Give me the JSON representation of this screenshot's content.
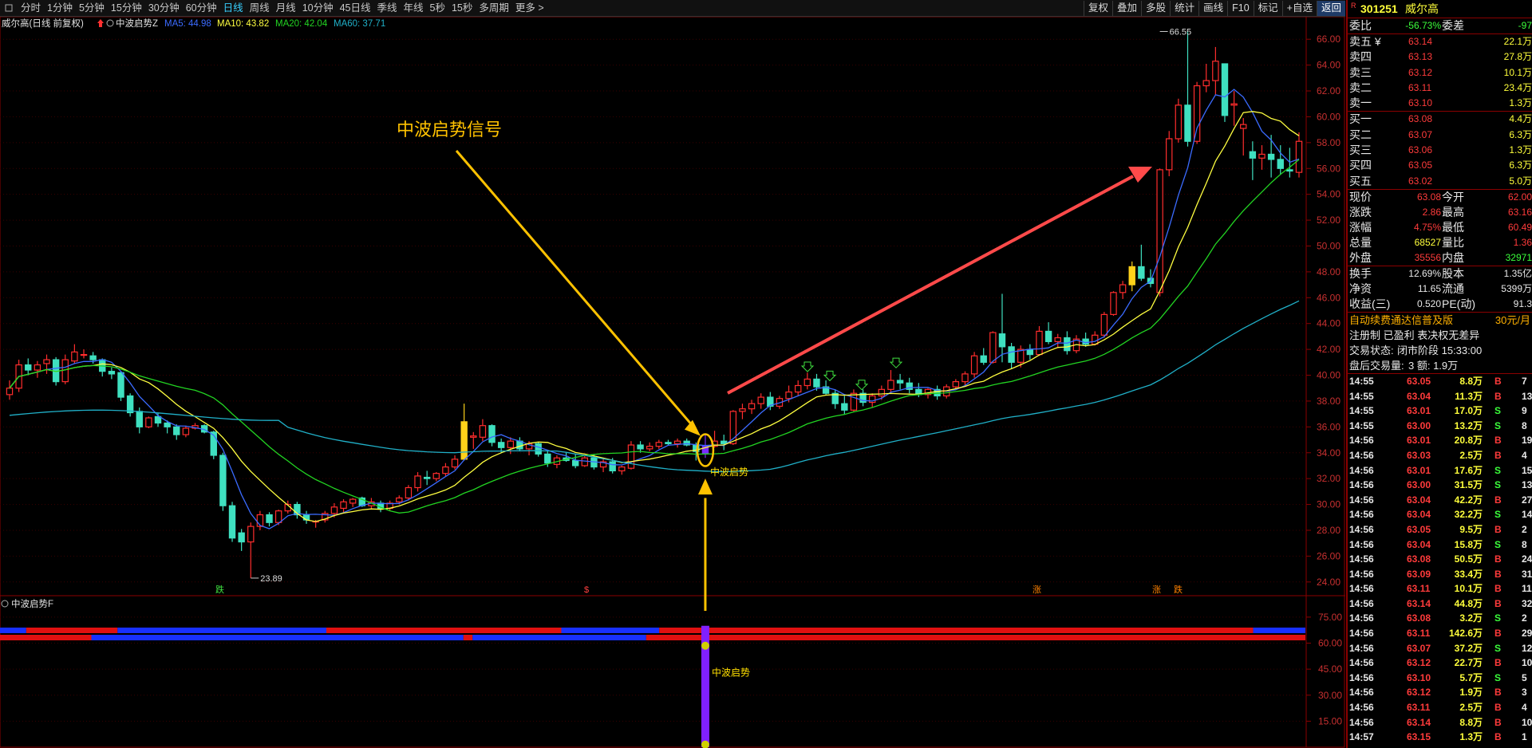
{
  "toolbar": {
    "periods": [
      "分时",
      "1分钟",
      "5分钟",
      "15分钟",
      "30分钟",
      "60分钟",
      "日线",
      "周线",
      "月线",
      "10分钟",
      "45日线",
      "季线",
      "年线",
      "5秒",
      "15秒",
      "多周期",
      "更多 >"
    ],
    "active_period": "日线",
    "right_buttons": [
      "复权",
      "叠加",
      "多股",
      "统计",
      "画线",
      "F10",
      "标记",
      "+自选",
      "返回"
    ]
  },
  "main_info": {
    "title": "威尔高(日线 前复权)",
    "indicator": "中波启势Z",
    "ma5": "MA5: 44.98",
    "ma10": "MA10: 43.82",
    "ma20": "MA20: 42.04",
    "ma60": "MA60: 37.71"
  },
  "annotation": {
    "text": "中波启势信号",
    "signal_label": "中波启势",
    "high_label": "66.55",
    "low_label": "23.89"
  },
  "markers": [
    "跌",
    "$",
    "涨",
    "涨",
    "跌"
  ],
  "sub_panel": {
    "title": "中波启势F",
    "signal_label": "中波启势",
    "yticks": [
      "75.00",
      "60.00",
      "45.00",
      "30.00",
      "15.00"
    ]
  },
  "price_axis": [
    "66.00",
    "64.00",
    "62.00",
    "60.00",
    "58.00",
    "56.00",
    "54.00",
    "52.00",
    "50.00",
    "48.00",
    "46.00",
    "44.00",
    "42.00",
    "40.00",
    "38.00",
    "36.00",
    "34.00",
    "32.00",
    "30.00",
    "28.00",
    "26.00",
    "24.00"
  ],
  "quote": {
    "badge": "R",
    "code": "301251",
    "name": "威尔高",
    "weibi_label": "委比",
    "weibi": "-56.73%",
    "weicha_label": "委差",
    "weicha": "-97",
    "asks": [
      {
        "label": "卖五 ¥",
        "price": "63.14",
        "vol": "22.1万"
      },
      {
        "label": "卖四",
        "price": "63.13",
        "vol": "27.8万"
      },
      {
        "label": "卖三",
        "price": "63.12",
        "vol": "10.1万"
      },
      {
        "label": "卖二",
        "price": "63.11",
        "vol": "23.4万"
      },
      {
        "label": "卖一",
        "price": "63.10",
        "vol": "1.3万"
      }
    ],
    "bids": [
      {
        "label": "买一",
        "price": "63.08",
        "vol": "4.4万"
      },
      {
        "label": "买二",
        "price": "63.07",
        "vol": "6.3万"
      },
      {
        "label": "买三",
        "price": "63.06",
        "vol": "1.3万"
      },
      {
        "label": "买四",
        "price": "63.05",
        "vol": "6.3万"
      },
      {
        "label": "买五",
        "price": "63.02",
        "vol": "5.0万"
      }
    ],
    "stats": [
      {
        "l1": "现价",
        "v1": "63.08",
        "c1": "red",
        "l2": "今开",
        "v2": "62.00",
        "c2": "red"
      },
      {
        "l1": "涨跌",
        "v1": "2.86",
        "c1": "red",
        "l2": "最高",
        "v2": "63.16",
        "c2": "red"
      },
      {
        "l1": "涨幅",
        "v1": "4.75%",
        "c1": "red",
        "l2": "最低",
        "v2": "60.49",
        "c2": "red"
      },
      {
        "l1": "总量",
        "v1": "68527",
        "c1": "yel",
        "l2": "量比",
        "v2": "1.36",
        "c2": "red"
      },
      {
        "l1": "外盘",
        "v1": "35556",
        "c1": "red",
        "l2": "内盘",
        "v2": "32971",
        "c2": "green"
      }
    ],
    "stats2": [
      {
        "l1": "换手",
        "v1": "12.69%",
        "l2": "股本",
        "v2": "1.35亿"
      },
      {
        "l1": "净资",
        "v1": "11.65",
        "l2": "流通",
        "v2": "5399万"
      },
      {
        "l1": "收益(三)",
        "v1": "0.520",
        "l2": "PE(动)",
        "v2": "91.3"
      }
    ],
    "ad_text": "自动续费通达信普及版",
    "ad_price": "30元/月",
    "reg_text": "注册制 已盈利 表决权无差异",
    "status_label": "交易状态:",
    "status_value": "闭市阶段 15:33:00",
    "after_label": "盘后交易量:",
    "after_value": "3 额: 1.9万"
  },
  "ticks": [
    {
      "t": "14:55",
      "p": "63.05",
      "v": "8.8万",
      "s": "B",
      "n": "7"
    },
    {
      "t": "14:55",
      "p": "63.04",
      "v": "11.3万",
      "s": "B",
      "n": "13"
    },
    {
      "t": "14:55",
      "p": "63.01",
      "v": "17.0万",
      "s": "S",
      "n": "9"
    },
    {
      "t": "14:55",
      "p": "63.00",
      "v": "13.2万",
      "s": "S",
      "n": "8"
    },
    {
      "t": "14:56",
      "p": "63.01",
      "v": "20.8万",
      "s": "B",
      "n": "19"
    },
    {
      "t": "14:56",
      "p": "63.03",
      "v": "2.5万",
      "s": "B",
      "n": "4"
    },
    {
      "t": "14:56",
      "p": "63.01",
      "v": "17.6万",
      "s": "S",
      "n": "15"
    },
    {
      "t": "14:56",
      "p": "63.00",
      "v": "31.5万",
      "s": "S",
      "n": "13"
    },
    {
      "t": "14:56",
      "p": "63.04",
      "v": "42.2万",
      "s": "B",
      "n": "27"
    },
    {
      "t": "14:56",
      "p": "63.04",
      "v": "32.2万",
      "s": "S",
      "n": "14"
    },
    {
      "t": "14:56",
      "p": "63.05",
      "v": "9.5万",
      "s": "B",
      "n": "2"
    },
    {
      "t": "14:56",
      "p": "63.04",
      "v": "15.8万",
      "s": "S",
      "n": "8"
    },
    {
      "t": "14:56",
      "p": "63.08",
      "v": "50.5万",
      "s": "B",
      "n": "24"
    },
    {
      "t": "14:56",
      "p": "63.09",
      "v": "33.4万",
      "s": "B",
      "n": "31"
    },
    {
      "t": "14:56",
      "p": "63.11",
      "v": "10.1万",
      "s": "B",
      "n": "11"
    },
    {
      "t": "14:56",
      "p": "63.14",
      "v": "44.8万",
      "s": "B",
      "n": "32"
    },
    {
      "t": "14:56",
      "p": "63.08",
      "v": "3.2万",
      "s": "S",
      "n": "2"
    },
    {
      "t": "14:56",
      "p": "63.11",
      "v": "142.6万",
      "s": "B",
      "n": "29"
    },
    {
      "t": "14:56",
      "p": "63.07",
      "v": "37.2万",
      "s": "S",
      "n": "12"
    },
    {
      "t": "14:56",
      "p": "63.12",
      "v": "22.7万",
      "s": "B",
      "n": "10"
    },
    {
      "t": "14:56",
      "p": "63.10",
      "v": "5.7万",
      "s": "S",
      "n": "5"
    },
    {
      "t": "14:56",
      "p": "63.12",
      "v": "1.9万",
      "s": "B",
      "n": "3"
    },
    {
      "t": "14:56",
      "p": "63.11",
      "v": "2.5万",
      "s": "B",
      "n": "4"
    },
    {
      "t": "14:56",
      "p": "63.14",
      "v": "8.8万",
      "s": "B",
      "n": "10"
    },
    {
      "t": "14:57",
      "p": "63.15",
      "v": "1.3万",
      "s": "B",
      "n": "1"
    }
  ],
  "chart_data": {
    "type": "candlestick",
    "ylim": [
      23,
      67
    ],
    "candles": [
      [
        38.5,
        39.6,
        38.1,
        39.0
      ],
      [
        39.0,
        41.2,
        38.7,
        40.8
      ],
      [
        40.8,
        41.3,
        40.0,
        40.4
      ],
      [
        40.4,
        41.1,
        39.8,
        40.8
      ],
      [
        40.9,
        41.6,
        40.1,
        41.2
      ],
      [
        41.2,
        41.4,
        39.2,
        39.5
      ],
      [
        39.5,
        41.6,
        39.3,
        41.2
      ],
      [
        41.1,
        42.4,
        40.9,
        41.8
      ],
      [
        41.6,
        42.0,
        41.3,
        41.6
      ],
      [
        41.5,
        41.8,
        40.9,
        41.2
      ],
      [
        41.2,
        41.3,
        39.9,
        40.3
      ],
      [
        40.3,
        40.6,
        39.7,
        40.1
      ],
      [
        40.2,
        40.3,
        38.0,
        38.3
      ],
      [
        38.4,
        38.6,
        36.8,
        37.1
      ],
      [
        37.2,
        37.5,
        35.5,
        36.0
      ],
      [
        36.0,
        36.8,
        35.9,
        36.7
      ],
      [
        36.8,
        37.1,
        36.0,
        36.3
      ],
      [
        36.3,
        36.5,
        35.5,
        36.0
      ],
      [
        36.0,
        36.2,
        35.0,
        35.4
      ],
      [
        35.4,
        36.1,
        35.2,
        35.9
      ],
      [
        35.9,
        36.3,
        35.8,
        36.1
      ],
      [
        36.1,
        36.2,
        35.5,
        35.6
      ],
      [
        35.6,
        35.7,
        33.5,
        33.8
      ],
      [
        33.8,
        34.0,
        29.5,
        29.9
      ],
      [
        29.9,
        30.2,
        27.1,
        27.4
      ],
      [
        27.8,
        28.1,
        26.4,
        27.1
      ],
      [
        27.1,
        28.6,
        24.3,
        28.3
      ],
      [
        28.3,
        29.5,
        28.0,
        29.2
      ],
      [
        29.2,
        29.4,
        28.3,
        28.6
      ],
      [
        28.6,
        29.6,
        28.4,
        29.5
      ],
      [
        29.5,
        30.3,
        29.3,
        30.0
      ],
      [
        30.0,
        30.2,
        28.9,
        29.2
      ],
      [
        29.2,
        29.5,
        28.5,
        28.8
      ],
      [
        28.7,
        28.8,
        28.2,
        28.7
      ],
      [
        28.8,
        29.5,
        28.6,
        29.3
      ],
      [
        29.3,
        30.1,
        29.0,
        29.8
      ],
      [
        29.7,
        30.4,
        29.4,
        30.2
      ],
      [
        30.1,
        30.5,
        29.8,
        30.4
      ],
      [
        30.5,
        30.6,
        29.8,
        29.9
      ],
      [
        29.9,
        30.5,
        29.7,
        30.2
      ],
      [
        30.1,
        30.3,
        29.4,
        29.7
      ],
      [
        29.7,
        30.3,
        29.5,
        30.1
      ],
      [
        30.2,
        30.7,
        30.0,
        30.5
      ],
      [
        30.5,
        31.5,
        30.3,
        31.3
      ],
      [
        31.3,
        32.5,
        31.0,
        32.2
      ],
      [
        32.1,
        32.6,
        31.5,
        32.0
      ],
      [
        32.0,
        32.5,
        31.8,
        32.4
      ],
      [
        32.4,
        33.2,
        32.2,
        32.9
      ],
      [
        32.9,
        33.8,
        32.7,
        33.5
      ],
      [
        33.5,
        37.8,
        33.4,
        36.4
      ],
      [
        35.2,
        35.6,
        34.3,
        35.3
      ],
      [
        35.2,
        36.6,
        34.9,
        36.1
      ],
      [
        36.1,
        36.2,
        34.5,
        34.8
      ],
      [
        34.8,
        35.1,
        34.0,
        34.4
      ],
      [
        34.4,
        35.2,
        33.9,
        34.9
      ],
      [
        34.9,
        35.2,
        34.1,
        34.3
      ],
      [
        34.3,
        34.9,
        33.8,
        34.7
      ],
      [
        34.7,
        34.8,
        33.7,
        33.9
      ],
      [
        33.9,
        34.2,
        32.9,
        33.2
      ],
      [
        33.1,
        33.8,
        32.8,
        33.6
      ],
      [
        33.6,
        34.0,
        33.3,
        33.4
      ],
      [
        33.4,
        33.9,
        32.8,
        33.0
      ],
      [
        33.0,
        33.8,
        32.9,
        33.6
      ],
      [
        33.6,
        33.9,
        32.7,
        32.9
      ],
      [
        32.9,
        33.5,
        32.5,
        33.3
      ],
      [
        33.3,
        33.6,
        32.4,
        32.6
      ],
      [
        32.6,
        33.0,
        32.3,
        32.9
      ],
      [
        32.8,
        34.9,
        32.7,
        34.6
      ],
      [
        34.6,
        34.9,
        34.0,
        34.3
      ],
      [
        34.3,
        34.8,
        34.1,
        34.5
      ],
      [
        34.5,
        35.0,
        34.3,
        34.8
      ],
      [
        34.8,
        35.0,
        34.6,
        34.7
      ],
      [
        34.7,
        35.1,
        34.4,
        34.9
      ],
      [
        34.9,
        35.1,
        34.5,
        34.6
      ],
      [
        34.6,
        34.8,
        33.4,
        34.1
      ],
      [
        33.9,
        35.4,
        33.6,
        34.5
      ],
      [
        34.5,
        35.7,
        34.4,
        34.9
      ],
      [
        34.9,
        35.4,
        34.2,
        34.7
      ],
      [
        34.7,
        37.3,
        34.6,
        37.2
      ],
      [
        37.2,
        37.8,
        36.6,
        37.4
      ],
      [
        37.4,
        38.1,
        37.0,
        37.8
      ],
      [
        37.8,
        38.6,
        37.4,
        38.3
      ],
      [
        38.3,
        38.7,
        37.3,
        37.6
      ],
      [
        37.6,
        38.4,
        37.4,
        38.2
      ],
      [
        38.2,
        39.2,
        37.9,
        38.7
      ],
      [
        38.7,
        39.6,
        38.4,
        39.2
      ],
      [
        39.2,
        40.2,
        38.9,
        39.7
      ],
      [
        39.7,
        40.1,
        38.8,
        39.1
      ],
      [
        39.1,
        39.6,
        38.5,
        38.6
      ],
      [
        38.6,
        38.9,
        37.4,
        37.8
      ],
      [
        37.8,
        38.4,
        37.0,
        37.3
      ],
      [
        37.3,
        38.9,
        37.2,
        38.6
      ],
      [
        38.6,
        38.9,
        37.6,
        37.9
      ],
      [
        37.9,
        38.6,
        37.5,
        38.4
      ],
      [
        38.4,
        39.2,
        38.1,
        38.9
      ],
      [
        38.9,
        40.4,
        38.6,
        39.6
      ],
      [
        39.6,
        40.1,
        38.9,
        39.4
      ],
      [
        39.4,
        39.8,
        38.6,
        38.9
      ],
      [
        38.9,
        39.4,
        38.3,
        38.5
      ],
      [
        38.5,
        39.0,
        38.2,
        38.9
      ],
      [
        38.9,
        39.2,
        38.1,
        38.4
      ],
      [
        38.4,
        39.3,
        38.2,
        39.1
      ],
      [
        39.1,
        39.7,
        38.9,
        39.5
      ],
      [
        39.5,
        40.3,
        39.2,
        40.1
      ],
      [
        40.1,
        41.8,
        39.8,
        41.5
      ],
      [
        41.5,
        42.1,
        40.8,
        41.0
      ],
      [
        41.0,
        43.4,
        40.9,
        43.3
      ],
      [
        43.2,
        46.3,
        41.0,
        42.2
      ],
      [
        42.2,
        42.5,
        40.5,
        41.0
      ],
      [
        41.0,
        42.3,
        40.6,
        42.0
      ],
      [
        42.0,
        42.4,
        41.2,
        41.6
      ],
      [
        41.6,
        43.8,
        41.5,
        43.4
      ],
      [
        43.4,
        44.1,
        42.4,
        42.6
      ],
      [
        42.6,
        43.2,
        42.1,
        42.9
      ],
      [
        42.9,
        43.4,
        41.6,
        41.9
      ],
      [
        41.9,
        43.1,
        41.7,
        42.8
      ],
      [
        42.8,
        43.3,
        42.2,
        42.4
      ],
      [
        42.4,
        43.4,
        42.3,
        43.1
      ],
      [
        43.1,
        44.9,
        42.9,
        44.7
      ],
      [
        44.7,
        46.5,
        44.6,
        46.4
      ],
      [
        46.4,
        47.3,
        45.9,
        47.0
      ],
      [
        47.0,
        48.8,
        46.5,
        48.4
      ],
      [
        48.4,
        50.1,
        47.3,
        47.5
      ],
      [
        47.5,
        48.2,
        46.8,
        47.1
      ],
      [
        46.4,
        56.0,
        46.1,
        55.9
      ],
      [
        55.9,
        58.9,
        55.4,
        58.3
      ],
      [
        58.3,
        61.4,
        58.0,
        60.9
      ],
      [
        60.9,
        66.6,
        57.7,
        58.1
      ],
      [
        58.1,
        62.7,
        57.9,
        62.4
      ],
      [
        62.4,
        64.1,
        61.9,
        62.8
      ],
      [
        62.8,
        65.4,
        61.7,
        64.3
      ],
      [
        64.1,
        63.8,
        59.6,
        60.1
      ],
      [
        60.9,
        62.0,
        59.3,
        61.0
      ],
      [
        59.1,
        59.9,
        57.0,
        59.4
      ],
      [
        57.3,
        58.1,
        55.1,
        56.8
      ],
      [
        56.8,
        57.8,
        55.9,
        57.1
      ],
      [
        57.1,
        58.6,
        55.3,
        56.7
      ],
      [
        56.7,
        57.8,
        55.5,
        56.0
      ],
      [
        55.9,
        57.6,
        55.3,
        55.8
      ],
      [
        55.7,
        58.8,
        55.3,
        58.1
      ]
    ]
  }
}
